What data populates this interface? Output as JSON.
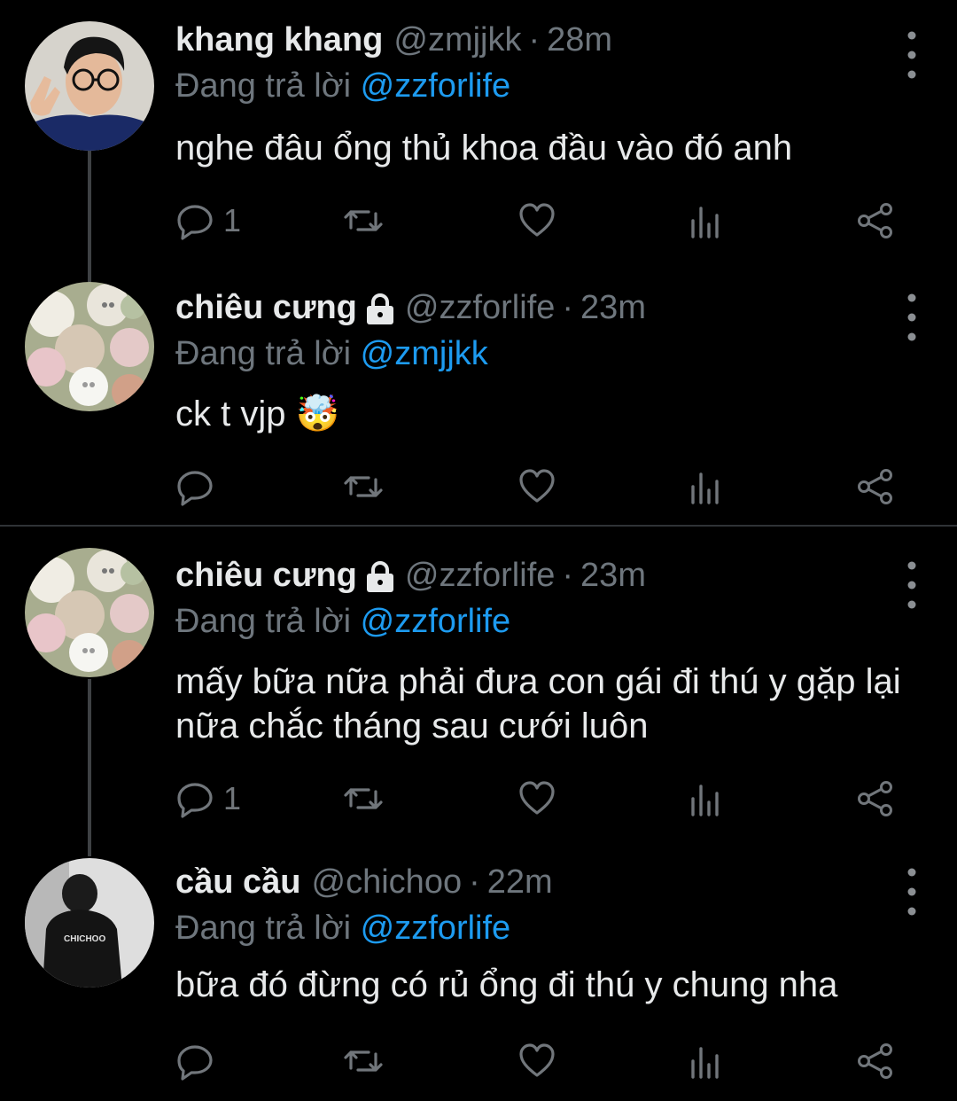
{
  "tweets": [
    {
      "name": "khang khang",
      "handle": "@zmjjkk",
      "separator": "·",
      "time": "28m",
      "reply_prefix": "Đang trả lời",
      "reply_mention": "@zzforlife",
      "text": "nghe đâu ổng thủ khoa đầu vào đó anh",
      "reply_count": "1",
      "locked": false
    },
    {
      "name": "chiêu cưng",
      "handle": "@zzforlife",
      "separator": "·",
      "time": "23m",
      "reply_prefix": "Đang trả lời",
      "reply_mention": "@zmjjkk",
      "text": "ck t vjp 🤯",
      "reply_count": "",
      "locked": true
    },
    {
      "name": "chiêu cưng",
      "handle": "@zzforlife",
      "separator": "·",
      "time": "23m",
      "reply_prefix": "Đang trả lời",
      "reply_mention": "@zzforlife",
      "text": "mấy bữa nữa phải đưa con gái đi thú y gặp lại nữa chắc tháng sau cưới luôn",
      "reply_count": "1",
      "locked": true
    },
    {
      "name": "cầu cầu",
      "handle": "@chichoo",
      "separator": "·",
      "time": "22m",
      "reply_prefix": "Đang trả lời",
      "reply_mention": "@zzforlife",
      "text": "bữa đó đừng có rủ ổng đi thú y chung nha",
      "reply_count": "",
      "locked": false
    }
  ],
  "avatar_shirt_text": "CHICHOO",
  "colors": {
    "background": "#000000",
    "text": "#e7e9ea",
    "muted": "#6e767d",
    "link": "#1d9bf0",
    "divider": "#2f3336"
  },
  "icons": [
    "reply-icon",
    "retweet-icon",
    "like-icon",
    "views-icon",
    "share-icon",
    "more-icon",
    "lock-icon"
  ]
}
